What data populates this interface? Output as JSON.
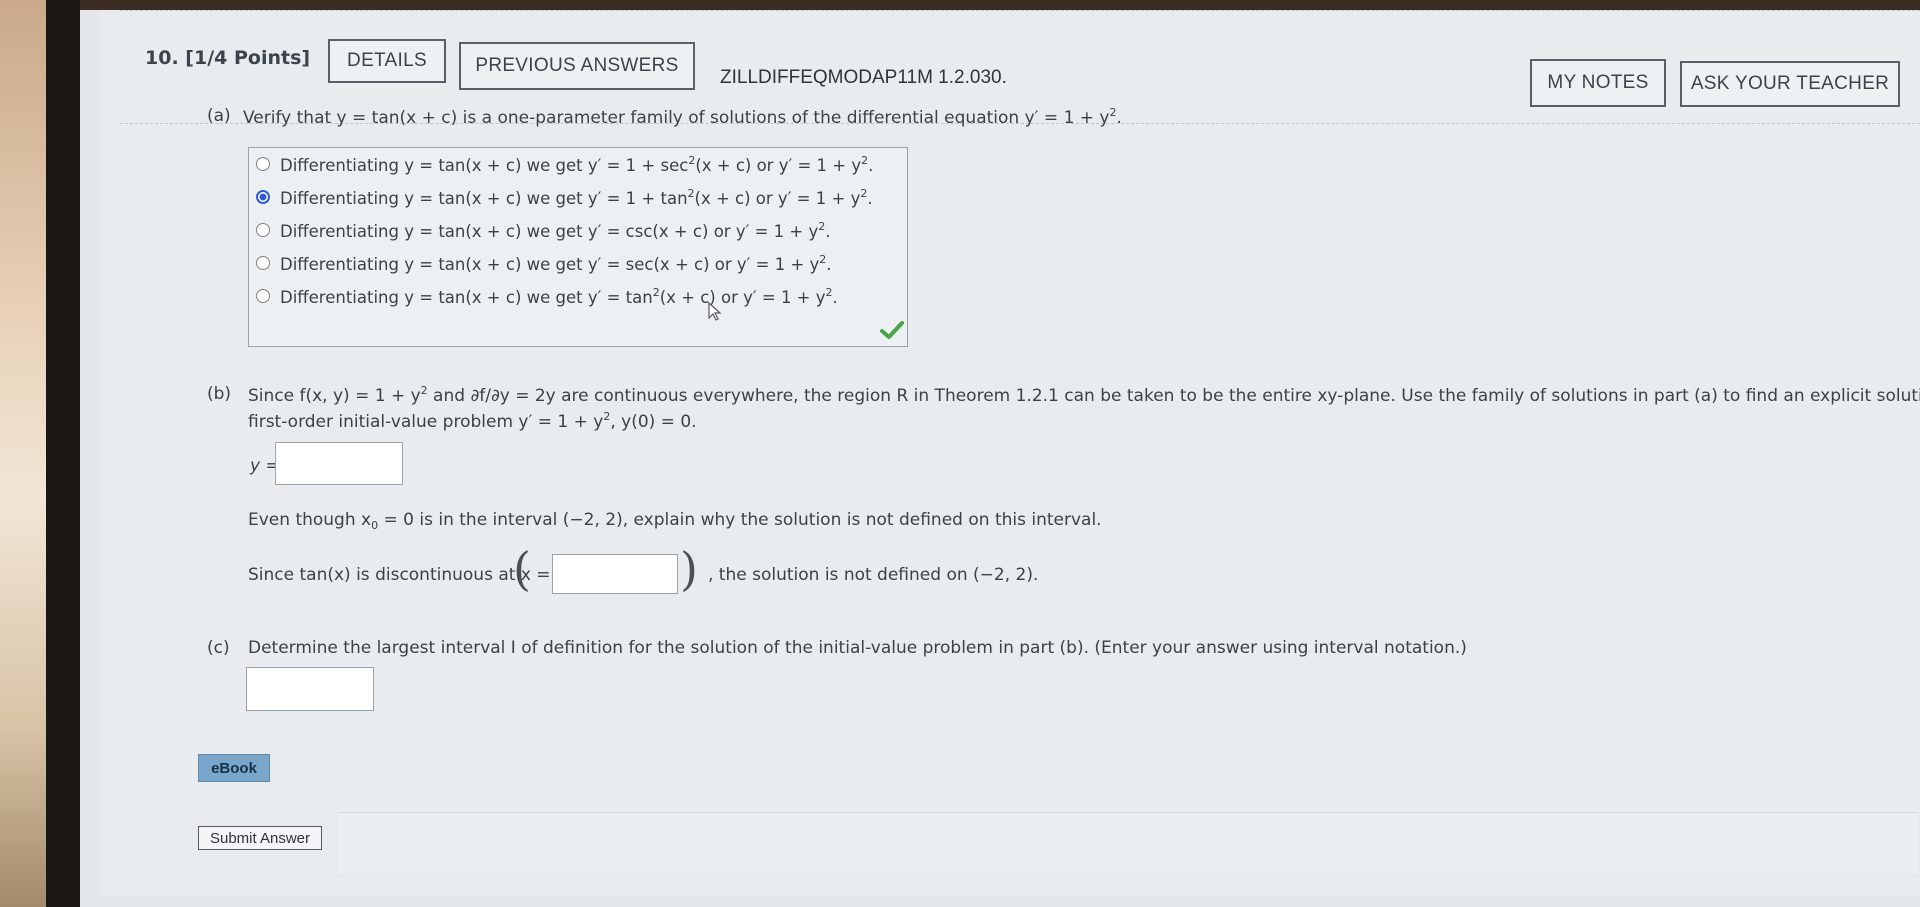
{
  "question": {
    "number_label": "10.",
    "points_label": "[1/4 Points]",
    "details_label": "DETAILS",
    "previous_answers_label": "PREVIOUS ANSWERS",
    "problem_code": "ZILLDIFFEQMODAP11M 1.2.030.",
    "my_notes_label": "MY NOTES",
    "ask_teacher_label": "ASK YOUR TEACHER"
  },
  "part_a": {
    "label": "(a)",
    "prompt_pre": "Verify that y = tan(x + c) is a one-parameter family of solutions of the differential equation y′ = 1 + y",
    "prompt_sup": "2",
    "prompt_post": ".",
    "options": [
      {
        "pre": "Differentiating y = tan(x + c) we get y′ = 1 + sec",
        "sup": "2",
        "post": "(x + c) or y′ = 1 + y",
        "sup2": "2",
        "end": ".",
        "selected": false
      },
      {
        "pre": "Differentiating y = tan(x + c) we get y′ = 1 + tan",
        "sup": "2",
        "post": "(x + c) or y′ = 1 + y",
        "sup2": "2",
        "end": ".",
        "selected": true
      },
      {
        "pre": "Differentiating y = tan(x + c) we get y′ = csc(x + c) or y′ = 1 + y",
        "sup": "2",
        "post": "",
        "sup2": "",
        "end": ".",
        "selected": false
      },
      {
        "pre": "Differentiating y = tan(x + c) we get y′ = sec(x + c) or y′ = 1 + y",
        "sup": "2",
        "post": "",
        "sup2": "",
        "end": ".",
        "selected": false
      },
      {
        "pre": "Differentiating y = tan(x + c) we get y′ = tan",
        "sup": "2",
        "post": "(x + c) or y′ = 1 + y",
        "sup2": "2",
        "end": ".",
        "selected": false
      }
    ],
    "status": "correct"
  },
  "part_b": {
    "label": "(b)",
    "line1_a": "Since f(x, y) = 1 + y",
    "line1_sup": "2",
    "line1_b": " and ∂f/∂y = 2y are continuous everywhere, the region R in Theorem 1.2.1 can be taken to be the entire xy-plane. Use the family of solutions in part (a) to find an explicit solution of the",
    "line2_a": "first-order initial-value problem y′ = 1 + y",
    "line2_sup": "2",
    "line2_b": ", y(0) = 0.",
    "y_label": "y =",
    "y_value": "",
    "explain_a": "Even though x",
    "explain_sub": "0",
    "explain_b": " = 0 is in the interval (−2, 2), explain why the solution is not defined on this interval.",
    "since_a": "Since tan(x) is discontinuous at x = ±",
    "since_value": "",
    "since_b": ", the solution is not defined on (−2, 2)."
  },
  "part_c": {
    "label": "(c)",
    "prompt": "Determine the largest interval I of definition for the solution of the initial-value problem in part (b). (Enter your answer using interval notation.)",
    "answer_value": ""
  },
  "ebook_label": "eBook",
  "submit_label": "Submit Answer"
}
